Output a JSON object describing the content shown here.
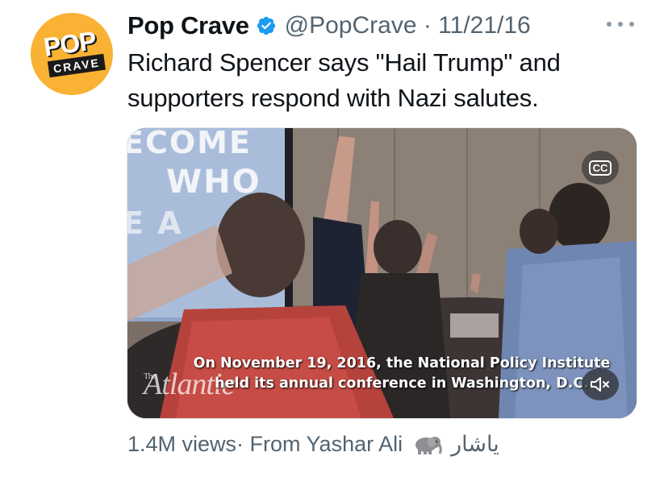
{
  "tweet": {
    "avatar": {
      "line1": "POP",
      "line2": "CRAVE"
    },
    "display_name": "Pop Crave",
    "handle_date": "@PopCrave · 11/21/16",
    "text": "Richard Spencer says \"Hail Trump\" and supporters respond with Nazi salutes.",
    "icons": {
      "verified": "verified-badge-icon",
      "more": "more-options-icon",
      "captions": "closed-captions-icon",
      "mute": "muted-speaker-icon",
      "elephant": "elephant-emoji"
    },
    "colors": {
      "verified": "#1d9bf0",
      "avatar_bg": "#f9b233",
      "muted_text": "#536471"
    }
  },
  "media": {
    "screen_text": {
      "line1": "ECOME",
      "line2": "WHO",
      "line3": "E A"
    },
    "watermark": {
      "the": "The",
      "brand": "Atlantic"
    },
    "captions_label": "CC",
    "caption_line1": "On November 19, 2016, the National Policy Institute",
    "caption_line2": "held its annual conference in Washington, D.C."
  },
  "footer": {
    "views": "1.4M views",
    "from": " · From Yashar Ali",
    "arabic": "ياشار"
  }
}
